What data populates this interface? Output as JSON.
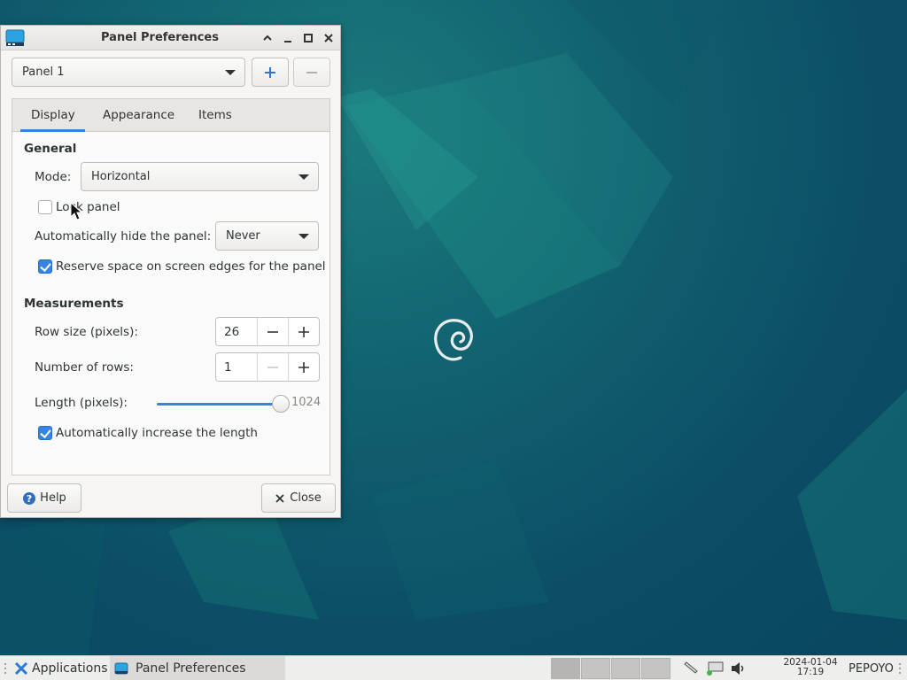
{
  "window": {
    "title": "Panel Preferences"
  },
  "panel_select": {
    "value": "Panel 1"
  },
  "tabs": [
    {
      "label": "Display",
      "active": true
    },
    {
      "label": "Appearance",
      "active": false
    },
    {
      "label": "Items",
      "active": false
    }
  ],
  "general": {
    "heading": "General",
    "mode_label": "Mode:",
    "mode_value": "Horizontal",
    "lock_panel_label": "Lock panel",
    "lock_panel_checked": false,
    "autohide_label": "Automatically hide the panel:",
    "autohide_value": "Never",
    "reserve_space_label": "Reserve space on screen edges for the panel",
    "reserve_space_checked": true
  },
  "measurements": {
    "heading": "Measurements",
    "row_size_label": "Row size (pixels):",
    "row_size_value": "26",
    "rows_label": "Number of rows:",
    "rows_value": "1",
    "length_label": "Length (pixels):",
    "length_value": "1024",
    "length_fraction": 1.0,
    "auto_length_label": "Automatically increase the length",
    "auto_length_checked": true
  },
  "footer": {
    "help_label": "Help",
    "close_label": "Close"
  },
  "taskbar": {
    "applications_label": "Applications",
    "task_label": "Panel Preferences",
    "date": "2024-01-04",
    "time": "17:19",
    "user": "PEPOYO"
  },
  "colors": {
    "accent": "#3584e4",
    "desktop": "#0c4f63"
  }
}
